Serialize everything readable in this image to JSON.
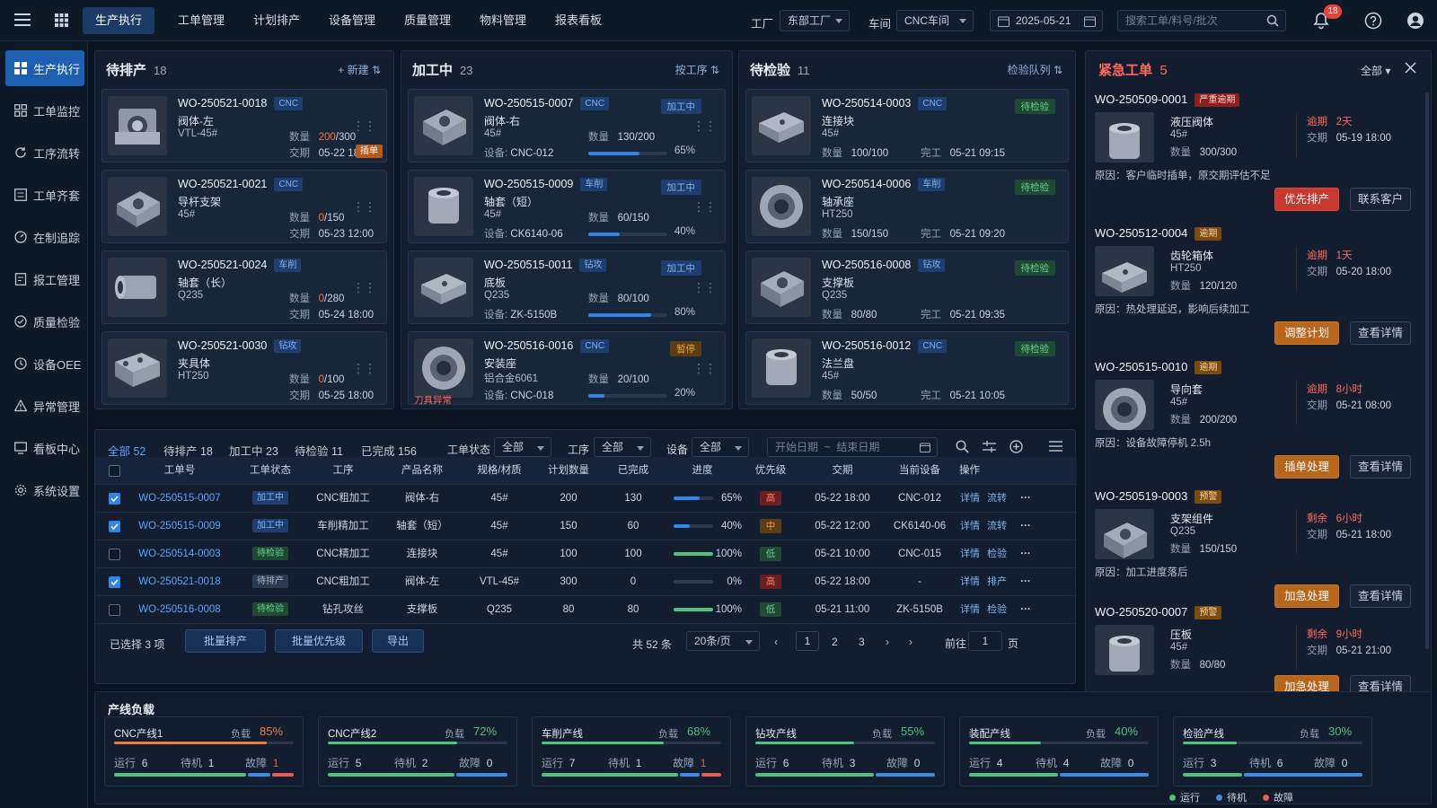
{
  "topbar": {
    "nav": [
      "生产执行",
      "工单管理",
      "计划排产",
      "设备管理",
      "质量管理",
      "物料管理",
      "报表看板"
    ],
    "factory_label": "工厂",
    "factory_value": "东部工厂",
    "workshop_label": "车间",
    "workshop_value": "CNC车间",
    "date_value": "2025-05-21",
    "search_placeholder": "搜索工单/料号/批次",
    "notif_count": "18"
  },
  "sidebar": {
    "items": [
      "生产执行",
      "工单监控",
      "工序流转",
      "工单齐套",
      "在制追踪",
      "报工管理",
      "质量检验",
      "设备OEE",
      "异常管理",
      "看板中心",
      "系统设置"
    ]
  },
  "columns": {
    "pending": {
      "title": "待排产",
      "count": "18",
      "action": "+ 新建",
      "cards": [
        {
          "wo": "WO-250521-0018",
          "tag": "CNC",
          "name": "阀体-左",
          "mat": "VTL-45#",
          "qty_label": "数量",
          "qty_done": "200",
          "qty_total": "/300",
          "due_label": "交期",
          "due": "05-22 18:00",
          "badge": "插单"
        },
        {
          "wo": "WO-250521-0021",
          "tag": "CNC",
          "name": "导杆支架",
          "mat": "45#",
          "qty_label": "数量",
          "qty_done": "0",
          "qty_total": "/150",
          "due_label": "交期",
          "due": "05-23 12:00",
          "badge": ""
        },
        {
          "wo": "WO-250521-0024",
          "tag": "车削",
          "name": "轴套（长）",
          "mat": "Q235",
          "qty_label": "数量",
          "qty_done": "0",
          "qty_total": "/280",
          "due_label": "交期",
          "due": "05-24 18:00",
          "badge": ""
        },
        {
          "wo": "WO-250521-0030",
          "tag": "钻攻",
          "name": "夹具体",
          "mat": "HT250",
          "qty_label": "数量",
          "qty_done": "0",
          "qty_total": "/100",
          "due_label": "交期",
          "due": "05-25 18:00",
          "badge": ""
        }
      ]
    },
    "processing": {
      "title": "加工中",
      "count": "23",
      "action": "按工序",
      "cards": [
        {
          "wo": "WO-250515-0007",
          "tag": "CNC",
          "status": "加工中",
          "name": "阀体-右",
          "mat": "45#",
          "qty_label": "数量",
          "qty": "130/200",
          "dev_label": "设备:",
          "dev": "CNC-012",
          "progress": 0.65,
          "pct": "65%"
        },
        {
          "wo": "WO-250515-0009",
          "tag": "车削",
          "status": "加工中",
          "name": "轴套（短）",
          "mat": "45#",
          "qty_label": "数量",
          "qty": "60/150",
          "dev_label": "设备:",
          "dev": "CK6140-06",
          "progress": 0.4,
          "pct": "40%"
        },
        {
          "wo": "WO-250515-0011",
          "tag": "钻攻",
          "status": "加工中",
          "name": "底板",
          "mat": "Q235",
          "qty_label": "数量",
          "qty": "80/100",
          "dev_label": "设备:",
          "dev": "ZK-5150B",
          "progress": 0.8,
          "pct": "80%"
        },
        {
          "wo": "WO-250516-0016",
          "tag": "CNC",
          "status": "暂停",
          "name": "安装座",
          "mat": "铝合金6061",
          "qty_label": "数量",
          "qty": "20/100",
          "dev_label": "设备:",
          "dev": "CNC-018",
          "progress": 0.2,
          "pct": "20%",
          "alert": "刀具异常"
        }
      ]
    },
    "inspection": {
      "title": "待检验",
      "count": "11",
      "action": "检验队列",
      "cards": [
        {
          "wo": "WO-250514-0003",
          "tag": "CNC",
          "status": "待检验",
          "name": "连接块",
          "mat": "45#",
          "qty_label": "数量",
          "qty": "100/100",
          "done_label": "完工",
          "done": "05-21 09:15"
        },
        {
          "wo": "WO-250514-0006",
          "tag": "车削",
          "status": "待检验",
          "name": "轴承座",
          "mat": "HT250",
          "qty_label": "数量",
          "qty": "150/150",
          "done_label": "完工",
          "done": "05-21 09:20"
        },
        {
          "wo": "WO-250516-0008",
          "tag": "钻攻",
          "status": "待检验",
          "name": "支撑板",
          "mat": "Q235",
          "qty_label": "数量",
          "qty": "80/80",
          "done_label": "完工",
          "done": "05-21 09:35"
        },
        {
          "wo": "WO-250516-0012",
          "tag": "CNC",
          "status": "待检验",
          "name": "法兰盘",
          "mat": "45#",
          "qty_label": "数量",
          "qty": "50/50",
          "done_label": "完工",
          "done": "05-21 10:05"
        }
      ]
    }
  },
  "table": {
    "tabs": [
      "全部 52",
      "待排产 18",
      "加工中 23",
      "待检验 11",
      "已完成 156"
    ],
    "filters": {
      "status_label": "工单状态",
      "status_value": "全部",
      "proc_label": "工序",
      "proc_value": "全部",
      "dev_label": "设备",
      "dev_value": "全部",
      "start_ph": "开始日期",
      "sep": "~",
      "end_ph": "结束日期"
    },
    "headers": [
      "工单号",
      "工单状态",
      "工序",
      "产品名称",
      "规格/材质",
      "计划数量",
      "已完成",
      "进度",
      "优先级",
      "交期",
      "当前设备",
      "操作"
    ],
    "rows": [
      {
        "checked": true,
        "wo": "WO-250515-0007",
        "status": "加工中",
        "proc": "CNC粗加工",
        "name": "阀体-右",
        "spec": "45#",
        "plan": "200",
        "done": "130",
        "progress": 0.65,
        "pct": "65%",
        "prio": "高",
        "due": "05-22 18:00",
        "dev": "CNC-012",
        "op1": "详情",
        "op2": "流转"
      },
      {
        "checked": true,
        "wo": "WO-250515-0009",
        "status": "加工中",
        "proc": "车削精加工",
        "name": "轴套（短）",
        "spec": "45#",
        "plan": "150",
        "done": "60",
        "progress": 0.4,
        "pct": "40%",
        "prio": "中",
        "due": "05-22 12:00",
        "dev": "CK6140-06",
        "op1": "详情",
        "op2": "流转"
      },
      {
        "checked": false,
        "wo": "WO-250514-0003",
        "status": "待检验",
        "proc": "CNC精加工",
        "name": "连接块",
        "spec": "45#",
        "plan": "100",
        "done": "100",
        "progress": 1.0,
        "pct": "100%",
        "prio": "低",
        "due": "05-21 10:00",
        "dev": "CNC-015",
        "op1": "详情",
        "op2": "检验"
      },
      {
        "checked": true,
        "wo": "WO-250521-0018",
        "status": "待排产",
        "proc": "CNC粗加工",
        "name": "阀体-左",
        "spec": "VTL-45#",
        "plan": "300",
        "done": "0",
        "progress": 0.0,
        "pct": "0%",
        "prio": "高",
        "due": "05-22 18:00",
        "dev": "-",
        "op1": "详情",
        "op2": "排产"
      },
      {
        "checked": false,
        "wo": "WO-250516-0008",
        "status": "待检验",
        "proc": "钻孔攻丝",
        "name": "支撑板",
        "spec": "Q235",
        "plan": "80",
        "done": "80",
        "progress": 1.0,
        "pct": "100%",
        "prio": "低",
        "due": "05-21 11:00",
        "dev": "ZK-5150B",
        "op1": "详情",
        "op2": "检验"
      }
    ],
    "footer": {
      "selected": "已选择 3 项",
      "btn1": "批量排产",
      "btn2": "批量优先级",
      "btn3": "导出",
      "total": "共 52 条",
      "page_size": "20条/页",
      "pages": [
        "1",
        "2",
        "3"
      ],
      "goto_label": "前往",
      "goto_value": "1",
      "page_suffix": "页"
    }
  },
  "urgent": {
    "title": "紧急工单",
    "count": "5",
    "filter": "全部",
    "items": [
      {
        "wo": "WO-250509-0001",
        "tag": "严重逾期",
        "tag_color": "red",
        "name": "液压阀体",
        "mat": "45#",
        "qty_label": "数量",
        "qty": "300/300",
        "t_label": "逾期",
        "t_value": "2天",
        "due_label": "交期",
        "due": "05-19 18:00",
        "reason": "原因：客户临时插单，原交期评估不足",
        "btn1": "优先排产",
        "btn2": "联系客户"
      },
      {
        "wo": "WO-250512-0004",
        "tag": "逾期",
        "tag_color": "orange",
        "name": "齿轮箱体",
        "mat": "HT250",
        "qty_label": "数量",
        "qty": "120/120",
        "t_label": "逾期",
        "t_value": "1天",
        "due_label": "交期",
        "due": "05-20 18:00",
        "reason": "原因：热处理延迟，影响后续加工",
        "btn1": "调整计划",
        "btn2": "查看详情"
      },
      {
        "wo": "WO-250515-0010",
        "tag": "逾期",
        "tag_color": "orange",
        "name": "导向套",
        "mat": "45#",
        "qty_label": "数量",
        "qty": "200/200",
        "t_label": "逾期",
        "t_value": "8小时",
        "due_label": "交期",
        "due": "05-21 08:00",
        "reason": "原因：设备故障停机 2.5h",
        "btn1": "插单处理",
        "btn2": "查看详情"
      },
      {
        "wo": "WO-250519-0003",
        "tag": "预警",
        "tag_color": "orange",
        "name": "支架组件",
        "mat": "Q235",
        "qty_label": "数量",
        "qty": "150/150",
        "t_label": "剩余",
        "t_value": "6小时",
        "due_label": "交期",
        "due": "05-21 18:00",
        "reason": "原因：加工进度落后",
        "btn1": "加急处理",
        "btn2": "查看详情"
      },
      {
        "wo": "WO-250520-0007",
        "tag": "预警",
        "tag_color": "orange",
        "name": "压板",
        "mat": "45#",
        "qty_label": "数量",
        "qty": "80/80",
        "t_label": "剩余",
        "t_value": "9小时",
        "due_label": "交期",
        "due": "05-21 21:00",
        "reason": "",
        "btn1": "加急处理",
        "btn2": "查看详情"
      }
    ]
  },
  "lines": {
    "title": "产线负载",
    "load_label": "负载",
    "run_label": "运行",
    "idle_label": "待机",
    "fault_label": "故障",
    "items": [
      {
        "name": "CNC产线1",
        "load": "85%",
        "load_frac": 0.85,
        "load_color": "#f07a3c",
        "run": "6",
        "idle": "1",
        "fault": "1"
      },
      {
        "name": "CNC产线2",
        "load": "72%",
        "load_frac": 0.72,
        "load_color": "#4cc27a",
        "run": "5",
        "idle": "2",
        "fault": "0"
      },
      {
        "name": "车削产线",
        "load": "68%",
        "load_frac": 0.68,
        "load_color": "#4cc27a",
        "run": "7",
        "idle": "1",
        "fault": "1"
      },
      {
        "name": "钻攻产线",
        "load": "55%",
        "load_frac": 0.55,
        "load_color": "#4cc27a",
        "run": "6",
        "idle": "3",
        "fault": "0"
      },
      {
        "name": "装配产线",
        "load": "40%",
        "load_frac": 0.4,
        "load_color": "#4cc27a",
        "run": "4",
        "idle": "4",
        "fault": "0"
      },
      {
        "name": "检验产线",
        "load": "30%",
        "load_frac": 0.3,
        "load_color": "#4cc27a",
        "run": "3",
        "idle": "6",
        "fault": "0"
      }
    ],
    "legend": [
      "运行",
      "待机",
      "故障"
    ]
  },
  "colors": {
    "accent": "#2f86e8",
    "run": "#4cc27a",
    "idle": "#3a8ce6",
    "fault": "#ef5a4f",
    "warn": "#f0a23c"
  }
}
